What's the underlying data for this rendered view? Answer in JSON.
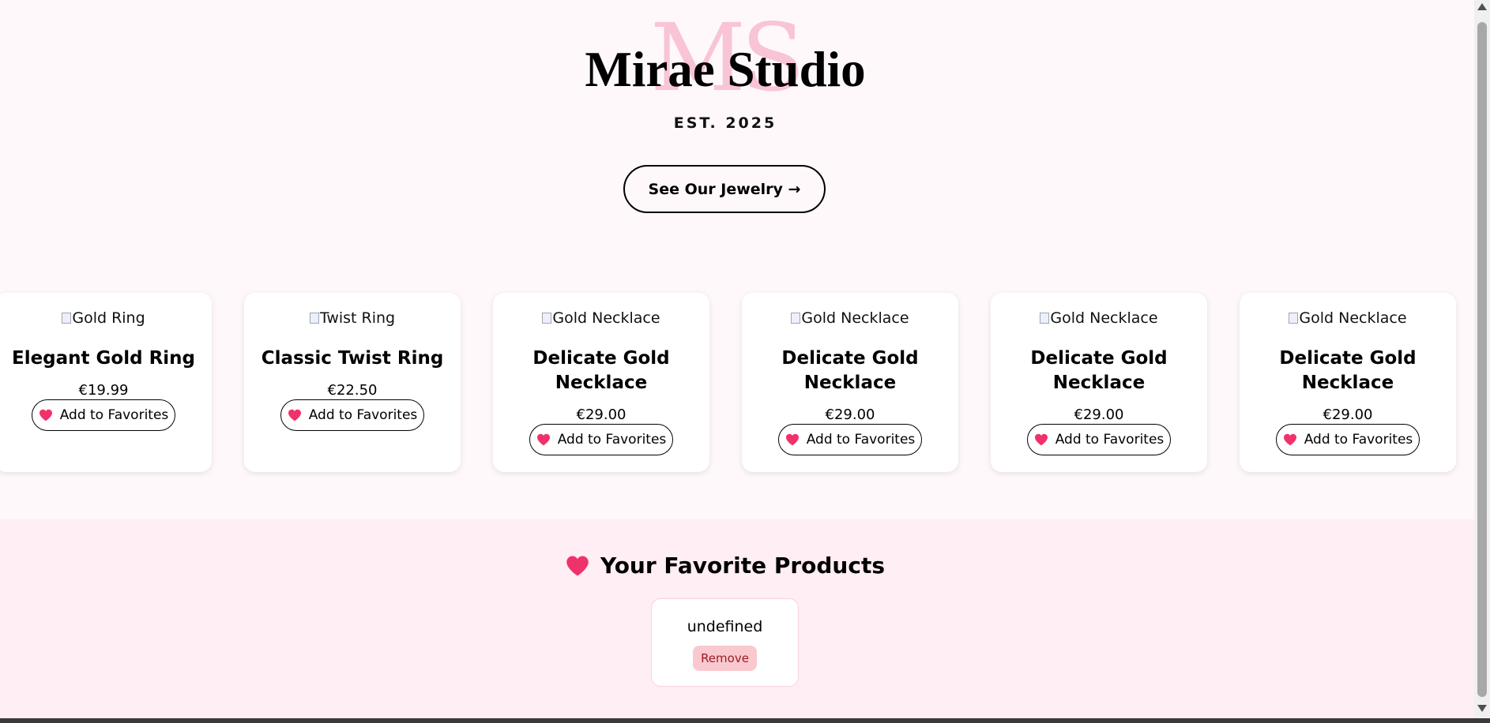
{
  "hero": {
    "monogram": "MS",
    "title": "Mirae Studio",
    "est": "EST. 2025",
    "cta_label": "See Our Jewelry →"
  },
  "products": [
    {
      "img_alt": "Gold Ring",
      "name": "Elegant Gold Ring",
      "price": "€19.99",
      "button": "Add to Favorites"
    },
    {
      "img_alt": "Twist Ring",
      "name": "Classic Twist Ring",
      "price": "€22.50",
      "button": "Add to Favorites"
    },
    {
      "img_alt": "Gold Necklace",
      "name": "Delicate Gold Necklace",
      "price": "€29.00",
      "button": "Add to Favorites"
    },
    {
      "img_alt": "Gold Necklace",
      "name": "Delicate Gold Necklace",
      "price": "€29.00",
      "button": "Add to Favorites"
    },
    {
      "img_alt": "Gold Necklace",
      "name": "Delicate Gold Necklace",
      "price": "€29.00",
      "button": "Add to Favorites"
    },
    {
      "img_alt": "Gold Necklace",
      "name": "Delicate Gold Necklace",
      "price": "€29.00",
      "button": "Add to Favorites"
    }
  ],
  "favorites": {
    "title": "Your Favorite Products",
    "items": [
      {
        "name": "undefined",
        "remove_label": "Remove"
      }
    ]
  },
  "colors": {
    "page_bg": "#fff8fa",
    "favorites_bg": "#ffeef3",
    "heart": "#f0326a",
    "monogram": "#f8c4d6",
    "remove_bg": "#f9c9cf",
    "remove_text": "#9b1c24"
  },
  "icons": {
    "heart": "heart-icon"
  }
}
